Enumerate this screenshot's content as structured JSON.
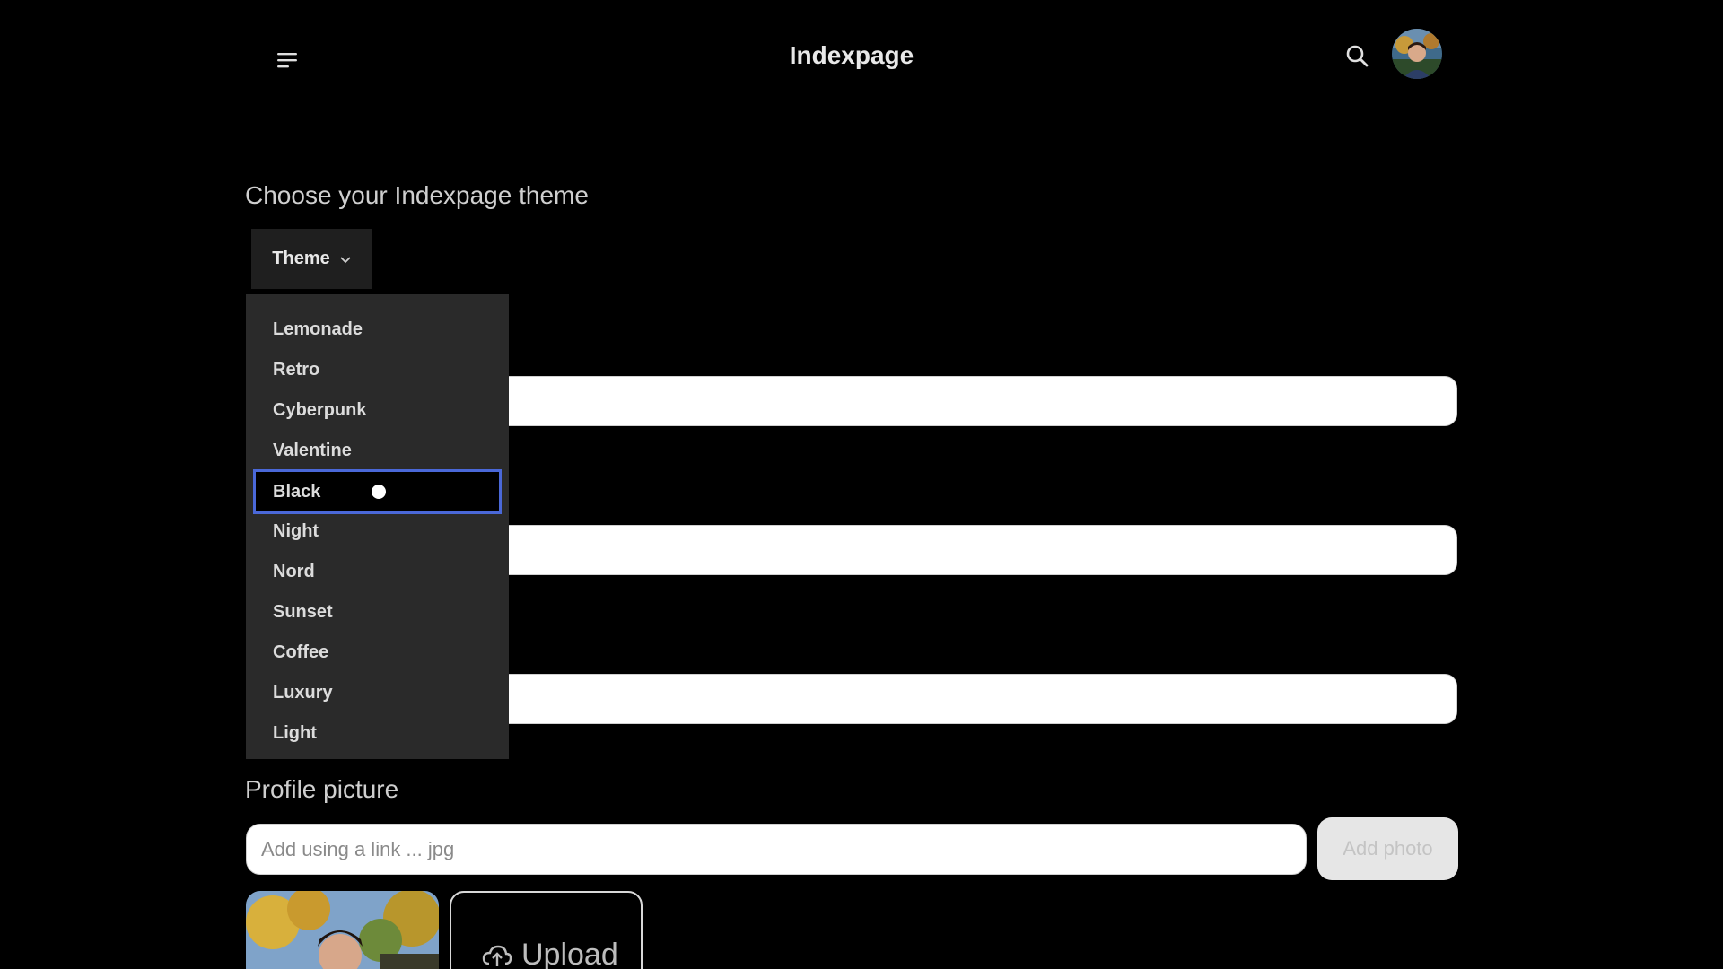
{
  "header": {
    "title": "Indexpage",
    "menu_icon": "hamburger-menu-icon",
    "search_icon": "search-icon",
    "avatar_alt": "avatar"
  },
  "theme_section": {
    "heading": "Choose your Indexpage theme",
    "dropdown_label": "Theme",
    "options": [
      "Lemonade",
      "Retro",
      "Cyberpunk",
      "Valentine",
      "Black",
      "Night",
      "Nord",
      "Sunset",
      "Coffee",
      "Luxury",
      "Light"
    ],
    "selected": "Black"
  },
  "profile_picture": {
    "heading": "Profile picture",
    "link_placeholder": "Add using a link ... jpg",
    "add_photo_label": "Add photo",
    "upload_label": "Upload"
  },
  "colors": {
    "background": "#000000",
    "menu_bg": "#2a2a2a",
    "focus_ring": "#4a68d8"
  }
}
